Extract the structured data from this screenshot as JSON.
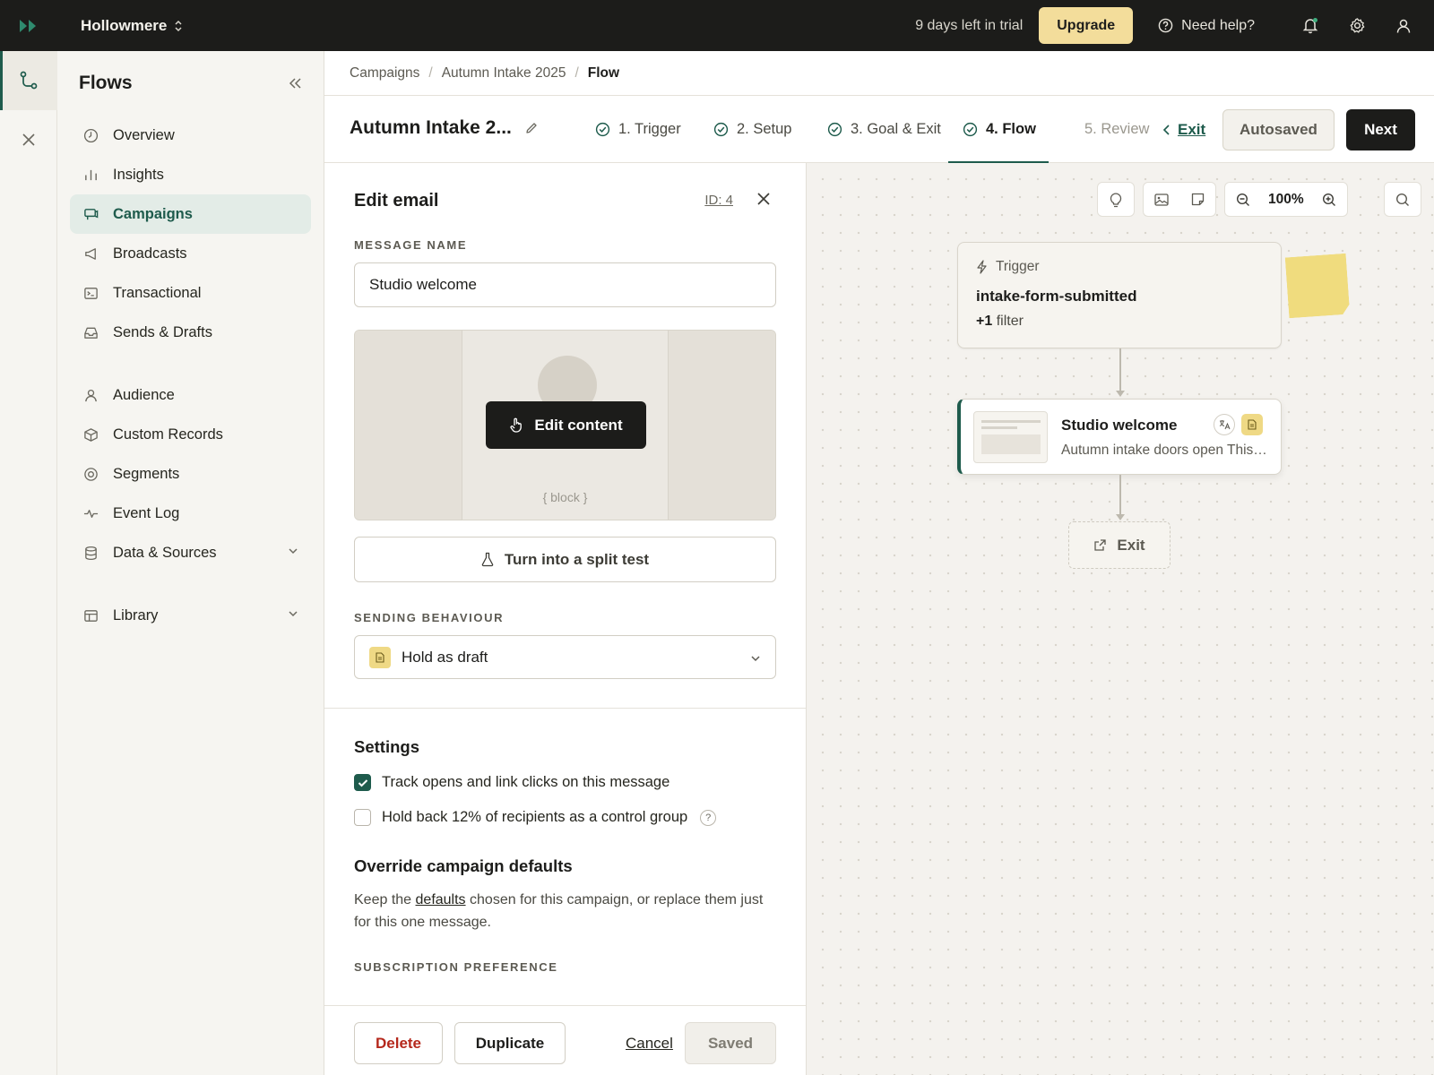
{
  "topbar": {
    "workspace": "Hollowmere",
    "trial_text": "9 days left in trial",
    "upgrade_label": "Upgrade",
    "help_label": "Need help?"
  },
  "sidebar": {
    "title": "Flows",
    "items": [
      {
        "label": "Overview",
        "icon": "clock-icon"
      },
      {
        "label": "Insights",
        "icon": "bar-chart-icon"
      },
      {
        "label": "Campaigns",
        "icon": "campaign-icon",
        "active": true
      },
      {
        "label": "Broadcasts",
        "icon": "megaphone-icon"
      },
      {
        "label": "Transactional",
        "icon": "terminal-icon"
      },
      {
        "label": "Sends & Drafts",
        "icon": "inbox-icon"
      },
      {
        "label": "Audience",
        "icon": "person-icon"
      },
      {
        "label": "Custom Records",
        "icon": "box-icon"
      },
      {
        "label": "Segments",
        "icon": "target-icon"
      },
      {
        "label": "Event Log",
        "icon": "activity-icon"
      },
      {
        "label": "Data & Sources",
        "icon": "database-icon",
        "expandable": true
      },
      {
        "label": "Library",
        "icon": "library-icon",
        "expandable": true
      }
    ]
  },
  "breadcrumbs": [
    "Campaigns",
    "Autumn Intake 2025",
    "Flow"
  ],
  "steps_bar": {
    "campaign_title": "Autumn Intake 2...",
    "steps": [
      {
        "label": "1. Trigger",
        "state": "done"
      },
      {
        "label": "2. Setup",
        "state": "done"
      },
      {
        "label": "3. Goal & Exit",
        "state": "done"
      },
      {
        "label": "4. Flow",
        "state": "active"
      },
      {
        "label": "5. Review",
        "state": "pending"
      }
    ],
    "exit_label": "Exit",
    "autosaved_label": "Autosaved",
    "next_label": "Next"
  },
  "edit_panel": {
    "title": "Edit email",
    "id_label": "ID: 4",
    "message_name_label": "MESSAGE NAME",
    "message_name_value": "Studio welcome",
    "edit_content_label": "Edit content",
    "block_placeholder": "{ block }",
    "split_test_label": "Turn into a split test",
    "sending_behaviour_label": "SENDING BEHAVIOUR",
    "sending_behaviour_value": "Hold as draft",
    "settings_heading": "Settings",
    "track_label": "Track opens and link clicks on this message",
    "track_checked": true,
    "holdback_label": "Hold back 12% of recipients as a control group",
    "holdback_checked": false,
    "override_heading": "Override campaign defaults",
    "override_text_1": "Keep the",
    "override_link": "defaults",
    "override_text_2": "chosen for this campaign, or replace them just for this one message.",
    "subscription_label": "SUBSCRIPTION PREFERENCE",
    "delete_label": "Delete",
    "duplicate_label": "Duplicate",
    "cancel_label": "Cancel",
    "saved_label": "Saved"
  },
  "canvas": {
    "zoom": "100%",
    "trigger": {
      "label": "Trigger",
      "event": "intake-form-submitted",
      "filter_count": "+1",
      "filter_word": "filter"
    },
    "message": {
      "title": "Studio welcome",
      "subtitle": "Autumn intake doors open This week — here's what to expect"
    },
    "exit_label": "Exit"
  },
  "colors": {
    "accent": "#1e5b4c",
    "topbar": "#1c1c1a",
    "upgrade": "#f3dd9b",
    "danger": "#b5281c",
    "sticky": "#f0dc7e"
  }
}
